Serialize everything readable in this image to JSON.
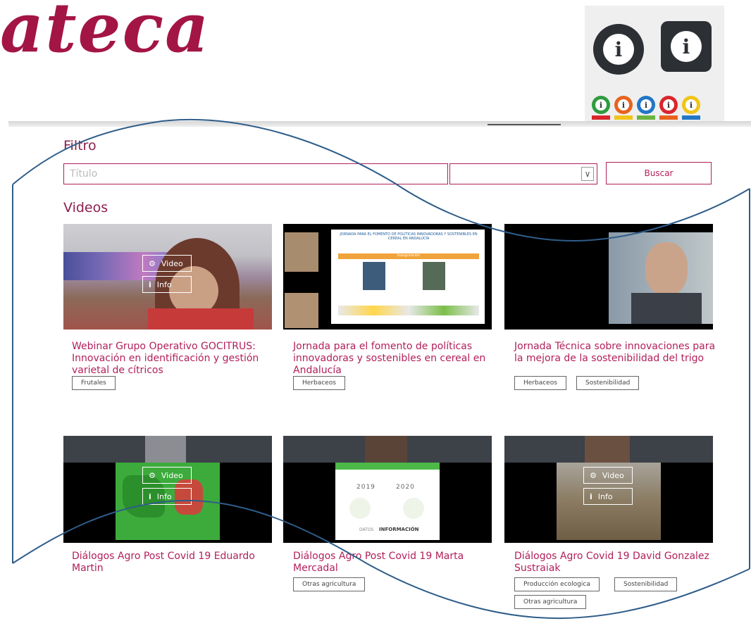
{
  "logo": {
    "text": "ateca",
    "color": "#a31545"
  },
  "info_graphic": {
    "icon_glyph": "i",
    "dot_colors": [
      "#2e9c3f",
      "#e8631d",
      "#2277c6",
      "#d9262c",
      "#f0c419"
    ],
    "dot_bar_colors": [
      "#d9262c",
      "#f0c419",
      "#6cb33f",
      "#e8631d",
      "#2277c6"
    ]
  },
  "filter": {
    "heading": "Filtro",
    "title_placeholder": "Título",
    "select_value": "",
    "search_button": "Buscar"
  },
  "videos": {
    "heading": "Videos",
    "overlay_video_label": "Video",
    "overlay_info_label": "Info",
    "cards": [
      {
        "title": "Webinar Grupo Operativo GOCITRUS: Innovación en identificación y gestión varietal de cítricos",
        "tags": [
          "Frutales"
        ]
      },
      {
        "title": "Jornada para el fomento de políticas innovadoras y sostenibles en cereal en Andalucía",
        "tags": [
          "Herbaceos"
        ]
      },
      {
        "title": "Jornada Técnica sobre innovaciones para la mejora de la sostenibilidad del trigo",
        "tags": [
          "Herbaceos",
          "Sostenibilidad"
        ]
      },
      {
        "title": "Diálogos Agro Post Covid 19 Eduardo Martin",
        "tags": []
      },
      {
        "title": "Diálogos Agro Post Covid 19 Marta Mercadal",
        "tags": [
          "Otras agricultura"
        ]
      },
      {
        "title": "Diálogos Agro Covid 19 David Gonzalez Sustraiak",
        "tags": [
          "Producción ecologica",
          "Sostenibilidad",
          "Otras agricultura"
        ]
      }
    ]
  },
  "slides": {
    "jornada_header": "JORNADA PARA EL FOMENTO DE POLÍTICAS INNOVADORAS Y SOSTENIBLES EN CEREAL EN ANDALUCÍA",
    "jornada_band": "Inauguración",
    "year_a": "2019",
    "year_b": "2020",
    "info_caption": "INFORMACIÓN",
    "info_prefix": "DATOS"
  },
  "colors": {
    "accent": "#b21f5a",
    "curve": "#2f5d8a"
  }
}
